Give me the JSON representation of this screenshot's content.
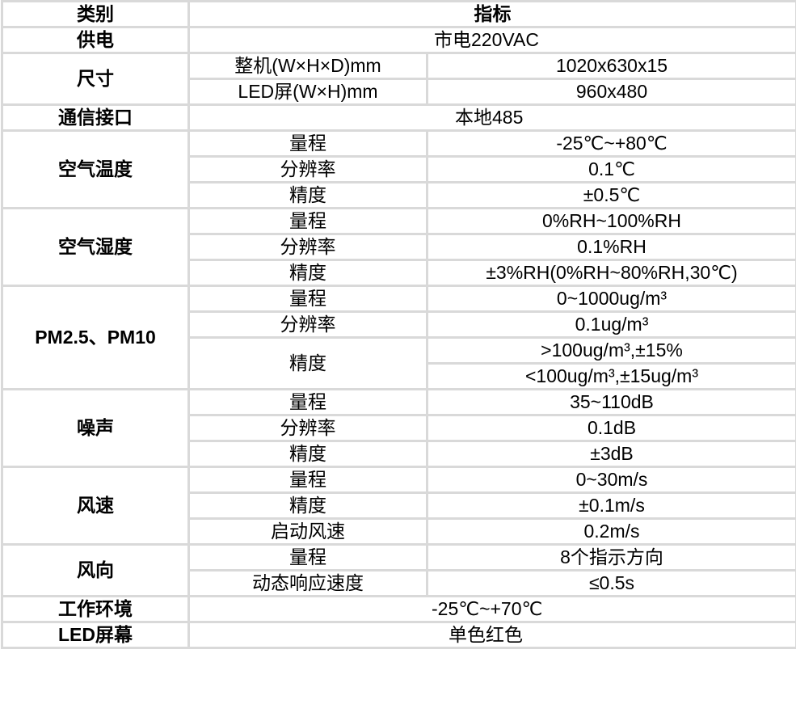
{
  "header": {
    "category": "类别",
    "spec": "指标"
  },
  "rows": {
    "power": {
      "category": "供电",
      "value": "市电220VAC"
    },
    "size": {
      "category": "尺寸",
      "items": [
        {
          "label": "整机(W×H×D)mm",
          "value": "1020x630x15"
        },
        {
          "label": "LED屏(W×H)mm",
          "value": "960x480"
        }
      ]
    },
    "comm": {
      "category": "通信接口",
      "value": "本地485"
    },
    "air_temp": {
      "category": "空气温度",
      "items": [
        {
          "label": "量程",
          "value": "-25℃~+80℃"
        },
        {
          "label": "分辨率",
          "value": "0.1℃"
        },
        {
          "label": "精度",
          "value": "±0.5℃"
        }
      ]
    },
    "air_humidity": {
      "category": "空气湿度",
      "items": [
        {
          "label": "量程",
          "value": "0%RH~100%RH"
        },
        {
          "label": "分辨率",
          "value": "0.1%RH"
        },
        {
          "label": "精度",
          "value": "±3%RH(0%RH~80%RH,30℃)"
        }
      ]
    },
    "pm": {
      "category": "PM2.5、PM10",
      "items": [
        {
          "label": "量程",
          "value": "0~1000ug/m³"
        },
        {
          "label": "分辨率",
          "value": "0.1ug/m³"
        },
        {
          "label": "精度",
          "values": [
            ">100ug/m³,±15%",
            "<100ug/m³,±15ug/m³"
          ]
        }
      ]
    },
    "noise": {
      "category": "噪声",
      "items": [
        {
          "label": "量程",
          "value": "35~110dB"
        },
        {
          "label": "分辨率",
          "value": "0.1dB"
        },
        {
          "label": "精度",
          "value": "±3dB"
        }
      ]
    },
    "wind_speed": {
      "category": "风速",
      "items": [
        {
          "label": "量程",
          "value": "0~30m/s"
        },
        {
          "label": "精度",
          "value": "±0.1m/s"
        },
        {
          "label": "启动风速",
          "value": "0.2m/s"
        }
      ]
    },
    "wind_dir": {
      "category": "风向",
      "items": [
        {
          "label": "量程",
          "value": "8个指示方向"
        },
        {
          "label": "动态响应速度",
          "value": "≤0.5s"
        }
      ]
    },
    "environment": {
      "category": "工作环境",
      "value": "-25℃~+70℃"
    },
    "led_screen": {
      "category": "LED屏幕",
      "value": "单色红色"
    }
  }
}
